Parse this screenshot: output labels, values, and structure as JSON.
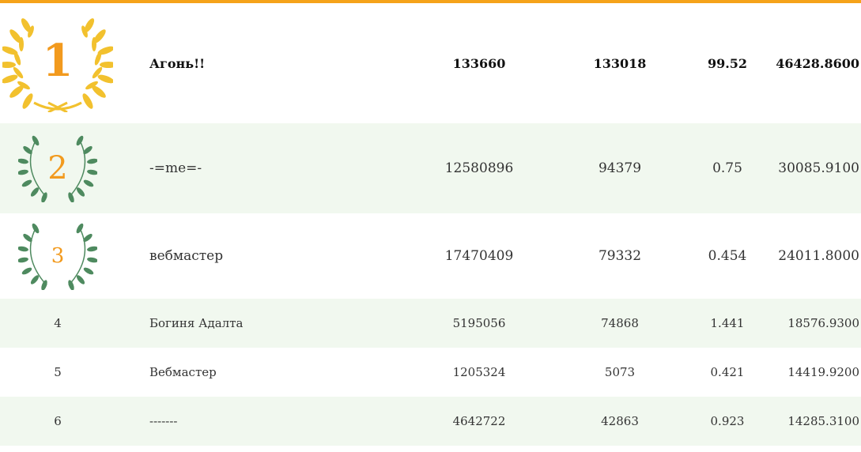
{
  "colors": {
    "accent_bar": "#f5a31a",
    "alt_row_bg": "#f1f8ef",
    "rank_number": "#f29a1e",
    "gold_wreath": "#f2c12e",
    "green_wreath": "#4e8a5f"
  },
  "rows": [
    {
      "rank": "1",
      "name": "Агонь!!",
      "col1": "133660",
      "col2": "133018",
      "col3": "99.52",
      "col4": "46428.8600",
      "badge": "gold-laurel-wreath-icon"
    },
    {
      "rank": "2",
      "name": "-=me=-",
      "col1": "12580896",
      "col2": "94379",
      "col3": "0.75",
      "col4": "30085.9100",
      "badge": "green-laurel-wreath-icon"
    },
    {
      "rank": "3",
      "name": "вебмастер",
      "col1": "17470409",
      "col2": "79332",
      "col3": "0.454",
      "col4": "24011.8000",
      "badge": "green-laurel-wreath-icon"
    },
    {
      "rank": "4",
      "name": "Богиня Адалта",
      "col1": "5195056",
      "col2": "74868",
      "col3": "1.441",
      "col4": "18576.9300"
    },
    {
      "rank": "5",
      "name": "Вебмастер",
      "col1": "1205324",
      "col2": "5073",
      "col3": "0.421",
      "col4": "14419.9200"
    },
    {
      "rank": "6",
      "name": "-------",
      "col1": "4642722",
      "col2": "42863",
      "col3": "0.923",
      "col4": "14285.3100"
    }
  ]
}
